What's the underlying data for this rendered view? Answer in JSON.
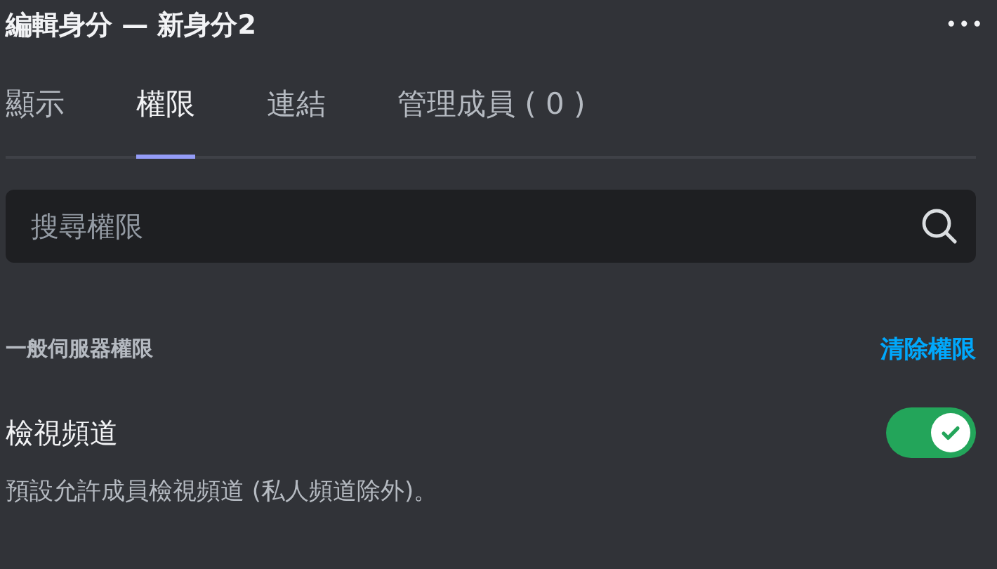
{
  "header": {
    "title": "編輯身分 — 新身分2",
    "more": "•••"
  },
  "tabs": [
    {
      "label": "顯示",
      "selected": false
    },
    {
      "label": "權限",
      "selected": true
    },
    {
      "label": "連結",
      "selected": false
    },
    {
      "label": "管理成員 ( 0 )",
      "selected": false
    }
  ],
  "search": {
    "placeholder": "搜尋權限"
  },
  "section": {
    "title": "一般伺服器權限",
    "action": "清除權限"
  },
  "permissions": [
    {
      "name": "檢視頻道",
      "on": true,
      "description": "預設允許成員檢視頻道 (私人頻道除外)。"
    }
  ]
}
